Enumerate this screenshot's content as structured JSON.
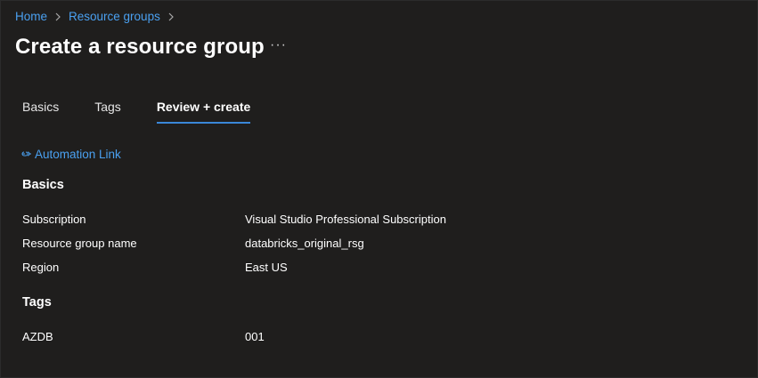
{
  "breadcrumb": {
    "items": [
      "Home",
      "Resource groups"
    ]
  },
  "page": {
    "title": "Create a resource group",
    "more_label": "···"
  },
  "tabs": [
    {
      "label": "Basics"
    },
    {
      "label": "Tags"
    },
    {
      "label": "Review + create",
      "active": true
    }
  ],
  "automation_link": "Automation Link",
  "basics": {
    "heading": "Basics",
    "rows": [
      {
        "key": "Subscription",
        "value": "Visual Studio Professional Subscription"
      },
      {
        "key": "Resource group name",
        "value": "databricks_original_rsg"
      },
      {
        "key": "Region",
        "value": "East US"
      }
    ]
  },
  "tags": {
    "heading": "Tags",
    "rows": [
      {
        "key": "AZDB",
        "value": "001"
      }
    ]
  },
  "colors": {
    "background": "#1f1e1d",
    "link": "#4aa0f0",
    "tab_underline": "#3a87d8"
  }
}
